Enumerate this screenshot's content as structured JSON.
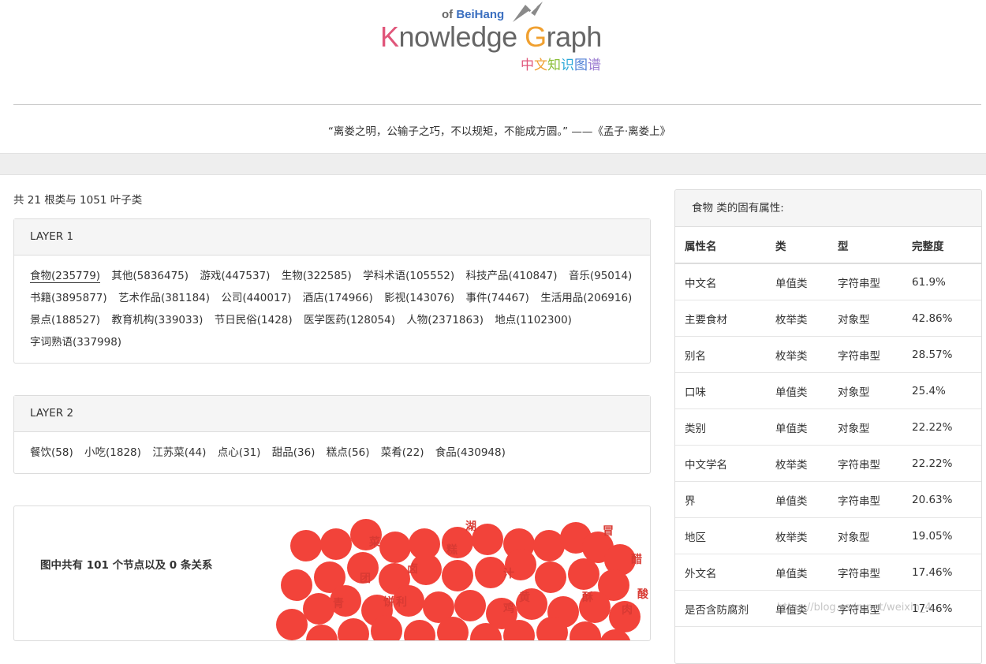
{
  "logo": {
    "of_text": "of ",
    "beihang": "BeiHang",
    "title_k": "K",
    "title_mid": "nowledge ",
    "title_g": "G",
    "title_end": "raph",
    "cn_title": [
      "中",
      "文",
      "知",
      "识",
      "图",
      "谱"
    ],
    "cn_colors": [
      "#e0567a",
      "#f0a030",
      "#8bbf3a",
      "#2aa7d8",
      "#4f7fd6",
      "#9a7ad0"
    ]
  },
  "quote": "“离娄之明，公输子之巧，不以规矩，不能成方圆。” ——《孟子·离娄上》",
  "summary": "共 21 根类与 1051 叶子类",
  "layer1": {
    "title": "LAYER 1",
    "tags": [
      "食物(235779)",
      "其他(5836475)",
      "游戏(447537)",
      "生物(322585)",
      "学科术语(105552)",
      "科技产品(410847)",
      "音乐(95014)",
      "书籍(3895877)",
      "艺术作品(381184)",
      "公司(440017)",
      "酒店(174966)",
      "影视(143076)",
      "事件(74467)",
      "生活用品(206916)",
      "景点(188527)",
      "教育机构(339033)",
      "节日民俗(1428)",
      "医学医药(128054)",
      "人物(2371863)",
      "地点(1102300)",
      "字词熟语(337998)"
    ]
  },
  "layer2": {
    "title": "LAYER 2",
    "tags": [
      "餐饮(58)",
      "小吃(1828)",
      "江苏菜(44)",
      "点心(31)",
      "甜品(36)",
      "糕点(56)",
      "菜肴(22)",
      "食品(430948)"
    ]
  },
  "graph": {
    "prefix": "图中共有 ",
    "nodes": "101",
    "middle": " 个节点以及 ",
    "relations": "0",
    "suffix": " 条关系",
    "node_color": "#f2433a",
    "label_color": "#d93a33",
    "labels": [
      "湖",
      "冒",
      "醋",
      "酸",
      "菜",
      "汁",
      "卤",
      "鸡",
      "肉",
      "饼",
      "酥",
      "糕",
      "团",
      "黄",
      "青",
      "利"
    ]
  },
  "attributes": {
    "title": "食物 类的固有属性:",
    "columns": [
      "属性名",
      "类",
      "型",
      "完整度"
    ],
    "rows": [
      [
        "中文名",
        "单值类",
        "字符串型",
        "61.9%"
      ],
      [
        "主要食材",
        "枚举类",
        "对象型",
        "42.86%"
      ],
      [
        "别名",
        "枚举类",
        "字符串型",
        "28.57%"
      ],
      [
        "口味",
        "单值类",
        "对象型",
        "25.4%"
      ],
      [
        "类别",
        "单值类",
        "对象型",
        "22.22%"
      ],
      [
        "中文学名",
        "枚举类",
        "字符串型",
        "22.22%"
      ],
      [
        "界",
        "单值类",
        "字符串型",
        "20.63%"
      ],
      [
        "地区",
        "枚举类",
        "对象型",
        "19.05%"
      ],
      [
        "外文名",
        "单值类",
        "字符串型",
        "17.46%"
      ],
      [
        "是否含防腐剂",
        "单值类",
        "字符串型",
        "17.46%"
      ]
    ]
  },
  "watermark": "https://blog.csdn.net/weixin_4..."
}
